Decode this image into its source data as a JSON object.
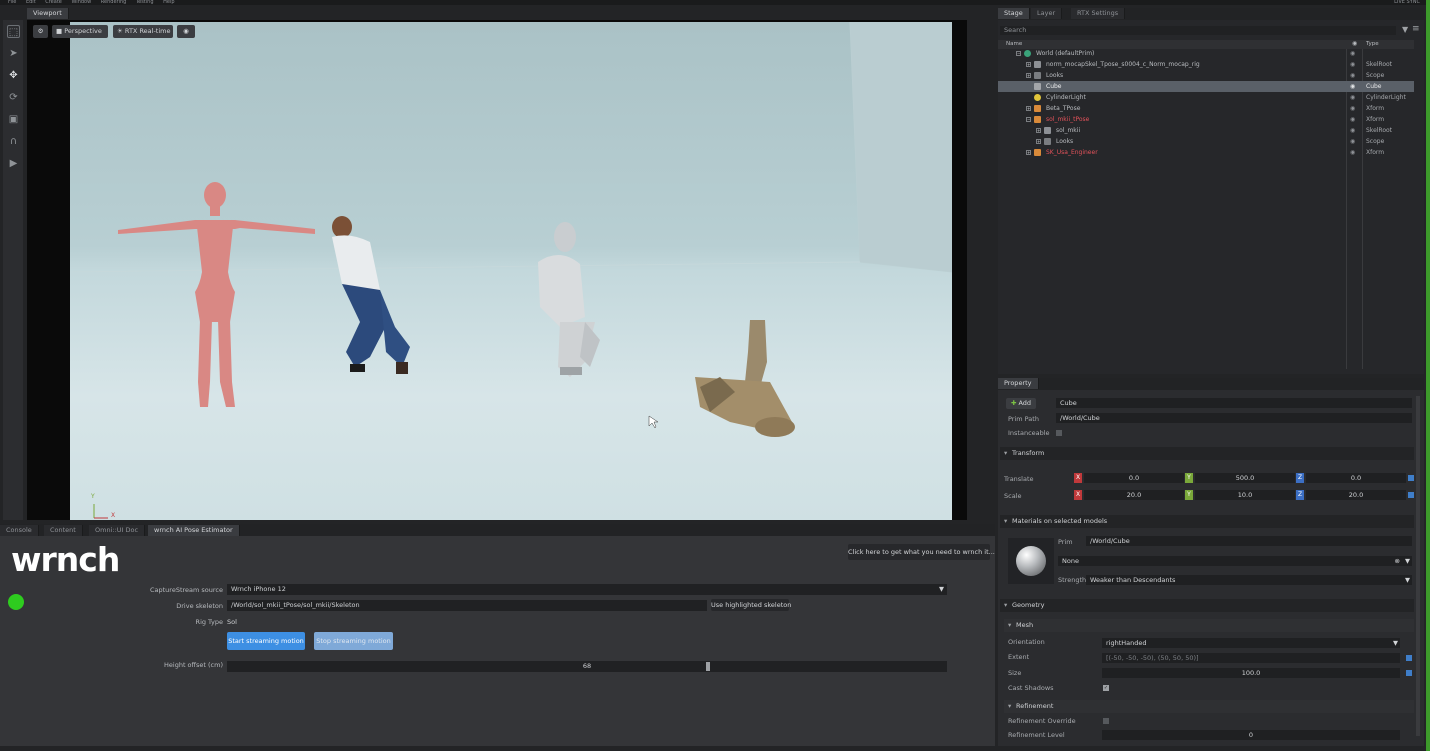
{
  "menubar": {
    "items": [
      "File",
      "Edit",
      "Create",
      "Window",
      "Rendering",
      "Testing",
      "Help"
    ],
    "right": "LIVE SYNC"
  },
  "viewport": {
    "tab": "Viewport",
    "toolbar": {
      "camera": "Perspective",
      "renderer": "RTX Real-time"
    },
    "axis_x": "X",
    "axis_y": "Y"
  },
  "bottom_tabs": [
    "Console",
    "Content",
    "Omni::UI Doc",
    "wrnch AI Pose Estimator"
  ],
  "wrnch": {
    "logo": "wrnch",
    "help_button": "Click here to get what you need to wrnch it...",
    "status_color": "#2ecc1f",
    "capture_source_label": "CaptureStream source",
    "capture_source_value": "Wrnch iPhone 12",
    "drive_skeleton_label": "Drive skeleton",
    "drive_skeleton_value": "/World/sol_mkii_tPose/sol_mkii/Skeleton",
    "use_highlighted_button": "Use highlighted skeleton",
    "rig_type_label": "Rig Type",
    "rig_type_value": "Sol",
    "start_button": "Start streaming motion",
    "stop_button": "Stop streaming motion",
    "height_offset_label": "Height offset (cm)",
    "height_offset_value": "68"
  },
  "stage": {
    "tabs": [
      "Stage",
      "Layer",
      "RTX Settings"
    ],
    "search_placeholder": "Search",
    "col_name": "Name",
    "col_type": "Type",
    "rows": [
      {
        "name": "World (defaultPrim)",
        "type": ""
      },
      {
        "name": "norm_mocapSkel_Tpose_s0004_c_Norm_mocap_rig",
        "type": "SkelRoot"
      },
      {
        "name": "Looks",
        "type": "Scope"
      },
      {
        "name": "Cube",
        "type": "Cube"
      },
      {
        "name": "CylinderLight",
        "type": "CylinderLight"
      },
      {
        "name": "Beta_TPose",
        "type": "Xform"
      },
      {
        "name": "sol_mkii_tPose",
        "type": "Xform"
      },
      {
        "name": "sol_mkii",
        "type": "SkelRoot"
      },
      {
        "name": "Looks",
        "type": "Scope"
      },
      {
        "name": "SK_Usa_Engineer",
        "type": "Xform"
      }
    ]
  },
  "property": {
    "tab": "Property",
    "add_button": "Add",
    "prim_name": "Cube",
    "prim_path_label": "Prim Path",
    "prim_path": "/World/Cube",
    "instanceable_label": "Instanceable",
    "transform_header": "Transform",
    "translate_label": "Translate",
    "translate": {
      "x": "0.0",
      "y": "500.0",
      "z": "0.0"
    },
    "scale_label": "Scale",
    "scale": {
      "x": "20.0",
      "y": "10.0",
      "z": "20.0"
    },
    "materials_header": "Materials on selected models",
    "prim_label": "Prim",
    "material_prim": "/World/Cube",
    "material_value": "None",
    "strength_label": "Strength",
    "strength_value": "Weaker than Descendants",
    "geometry_header": "Geometry",
    "mesh_header": "Mesh",
    "orientation_label": "Orientation",
    "orientation_value": "rightHanded",
    "extent_label": "Extent",
    "extent_value": "[(-50, -50, -50), (50, 50, 50)]",
    "size_label": "Size",
    "size_value": "100.0",
    "cast_shadows_label": "Cast Shadows",
    "refinement_header": "Refinement",
    "refinement_override_label": "Refinement Override",
    "refinement_level_label": "Refinement Level",
    "refinement_level_value": "0"
  },
  "colors": {
    "accent_blue": "#3d8fe3",
    "selected_row": "#5a6068",
    "red_prim": "#e3525a",
    "live_green": "#3d9a2b"
  }
}
